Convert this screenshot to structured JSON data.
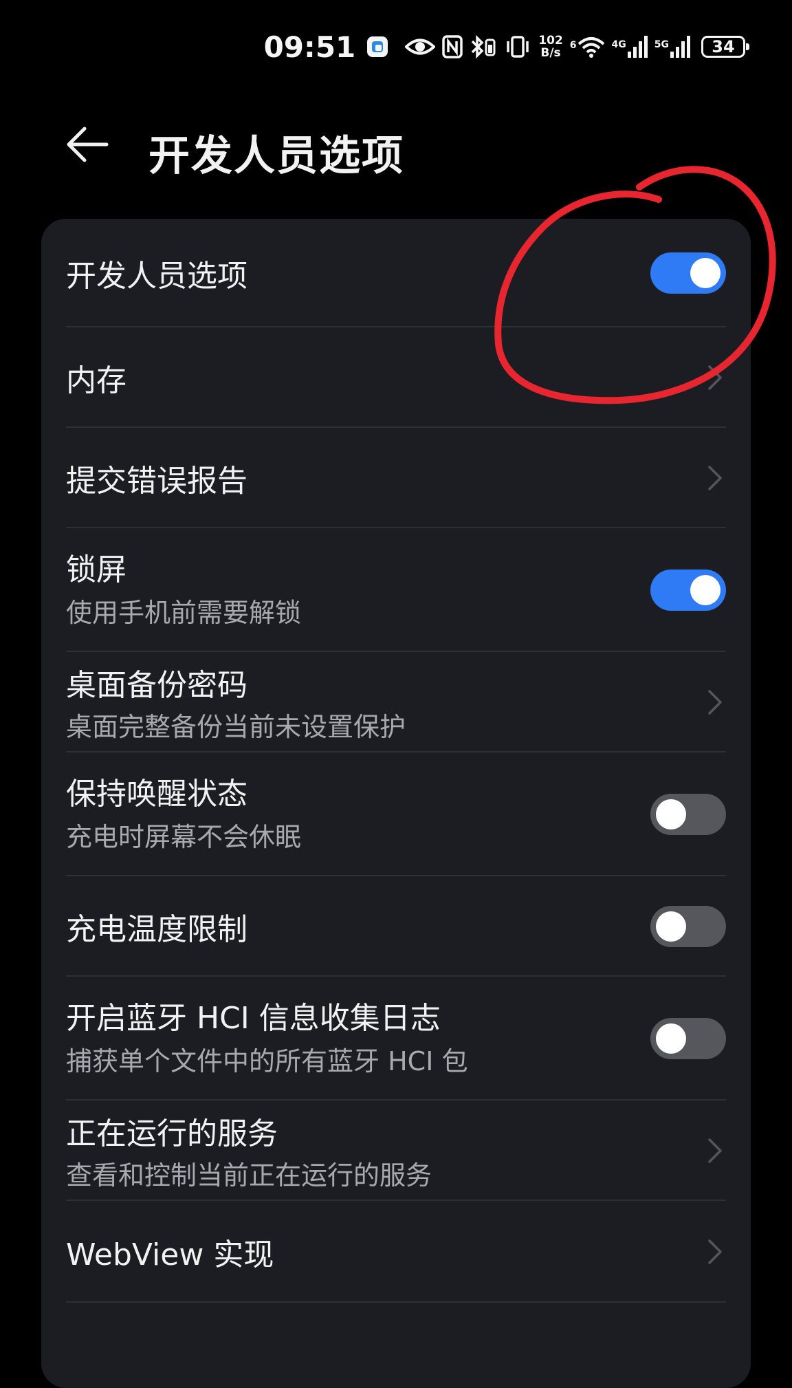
{
  "status_bar": {
    "time": "09:51",
    "net_speed_value": "102",
    "net_speed_unit": "B/s",
    "wifi_label": "6",
    "signal1_label": "4G",
    "signal2_label": "5G",
    "battery_level": "34"
  },
  "header": {
    "title": "开发人员选项"
  },
  "colors": {
    "background": "#000000",
    "card": "#1c1d22",
    "toggle_on": "#2f7af5",
    "toggle_off": "#56575c",
    "annotation": "#e8262f"
  },
  "settings": {
    "developer_options": {
      "title": "开发人员选项",
      "state": "on"
    },
    "memory": {
      "title": "内存"
    },
    "bug_report": {
      "title": "提交错误报告"
    },
    "lock_screen": {
      "title": "锁屏",
      "subtitle": "使用手机前需要解锁",
      "state": "on"
    },
    "backup_password": {
      "title": "桌面备份密码",
      "subtitle": "桌面完整备份当前未设置保护"
    },
    "stay_awake": {
      "title": "保持唤醒状态",
      "subtitle": "充电时屏幕不会休眠",
      "state": "off"
    },
    "charge_temp_limit": {
      "title": "充电温度限制",
      "state": "off"
    },
    "bluetooth_hci_log": {
      "title": "开启蓝牙 HCI 信息收集日志",
      "subtitle": "捕获单个文件中的所有蓝牙 HCI 包",
      "state": "off"
    },
    "running_services": {
      "title": "正在运行的服务",
      "subtitle": "查看和控制当前正在运行的服务"
    },
    "webview": {
      "title": "WebView 实现"
    }
  }
}
